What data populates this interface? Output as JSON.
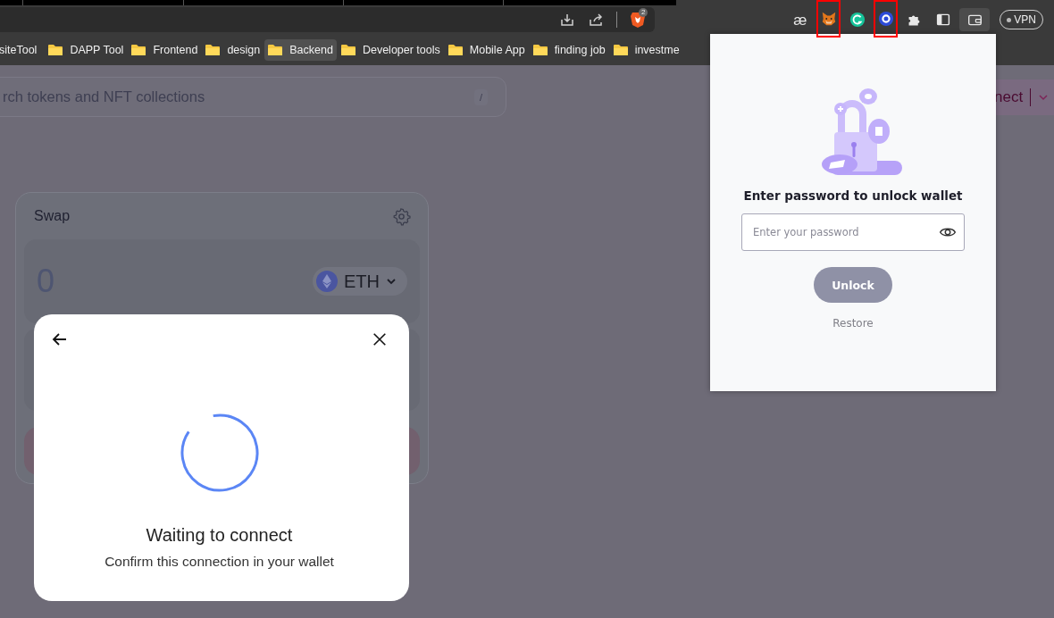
{
  "toolbar": {
    "brave_badge": "2",
    "extensions": [
      {
        "kind": "glyph",
        "glyph": "æ",
        "highlighted": false,
        "selected": false
      },
      {
        "kind": "fox",
        "highlighted": true,
        "selected": false
      },
      {
        "kind": "grammar",
        "highlighted": false,
        "selected": false
      },
      {
        "kind": "ring",
        "highlighted": true,
        "selected": false
      },
      {
        "kind": "puzzle",
        "highlighted": false,
        "selected": false
      },
      {
        "kind": "sidebar",
        "highlighted": false,
        "selected": false
      },
      {
        "kind": "wallet",
        "highlighted": false,
        "selected": true
      }
    ],
    "vpn": {
      "label": "VPN"
    }
  },
  "bookmarks": [
    {
      "label": "siteTool",
      "folder_icon": false,
      "selected": false
    },
    {
      "label": "DAPP Tool",
      "folder_icon": true,
      "selected": false
    },
    {
      "label": "Frontend",
      "folder_icon": true,
      "selected": false
    },
    {
      "label": "design",
      "folder_icon": true,
      "selected": false
    },
    {
      "label": "Backend",
      "folder_icon": true,
      "selected": true
    },
    {
      "label": "Developer tools",
      "folder_icon": true,
      "selected": false
    },
    {
      "label": "Mobile App",
      "folder_icon": true,
      "selected": false
    },
    {
      "label": "finding job",
      "folder_icon": true,
      "selected": false
    },
    {
      "label": "investme",
      "folder_icon": true,
      "selected": false
    }
  ],
  "search": {
    "placeholder": "rch tokens and NFT collections",
    "shortcut": "/"
  },
  "connect_button": {
    "label": "nect"
  },
  "swap_card": {
    "title": "Swap",
    "sell_amount": "0",
    "token": "ETH"
  },
  "connect_modal": {
    "title": "Waiting to connect",
    "message": "Confirm this connection in your wallet"
  },
  "wallet_popup": {
    "title": "Enter password to unlock wallet",
    "password": {
      "placeholder": "Enter your password"
    },
    "unlock_button": {
      "label": "Unlock",
      "disabled": true
    },
    "restore_link": "Restore"
  }
}
